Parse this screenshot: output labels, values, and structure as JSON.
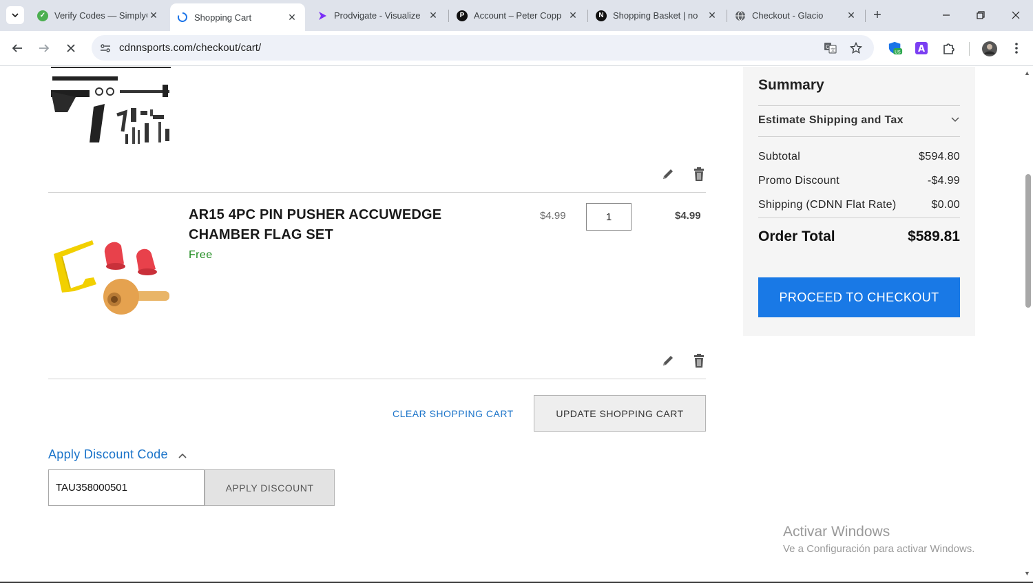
{
  "browser": {
    "tabs": [
      {
        "title": "Verify Codes — SimplyCodes",
        "favicon": "check-icon",
        "color": "#4caf50"
      },
      {
        "title": "Shopping Cart",
        "favicon": "loading-spinner-icon",
        "color": "#1a73e8",
        "active": true
      },
      {
        "title": "Prodvigate - Visualize",
        "favicon": "play-icon",
        "color": "#7b2ff7"
      },
      {
        "title": "Account – Peter Copp",
        "favicon": "p-logo-icon",
        "color": "#111111"
      },
      {
        "title": "Shopping Basket | no",
        "favicon": "n-logo-icon",
        "color": "#111111"
      },
      {
        "title": "Checkout - Glacio",
        "favicon": "globe-icon",
        "color": "#5f6368"
      }
    ],
    "url": "cdnnsports.com/checkout/cart/"
  },
  "cart": {
    "item": {
      "name": "AR15 4PC PIN PUSHER ACCUWEDGE CHAMBER FLAG SET",
      "tag": "Free",
      "price": "$4.99",
      "qty": "1",
      "subtotal": "$4.99"
    },
    "clear_label": "CLEAR SHOPPING CART",
    "update_label": "UPDATE SHOPPING CART",
    "discount": {
      "toggle_label": "Apply Discount Code",
      "code": "TAU358000501",
      "apply_label": "APPLY DISCOUNT"
    }
  },
  "summary": {
    "title": "Summary",
    "shipping_toggle": "Estimate Shipping and Tax",
    "rows": [
      {
        "label": "Subtotal",
        "value": "$594.80"
      },
      {
        "label": "Promo Discount",
        "value": "-$4.99"
      },
      {
        "label": "Shipping (CDNN Flat Rate)",
        "value": "$0.00"
      }
    ],
    "total_label": "Order Total",
    "total_value": "$589.81",
    "checkout_label": "PROCEED TO CHECKOUT"
  },
  "watermark": {
    "title": "Activar Windows",
    "subtitle": "Ve a Configuración para activar Windows."
  },
  "colors": {
    "accent": "#1979e6",
    "link": "#1a73c9",
    "free_tag": "#1c8a1c"
  }
}
